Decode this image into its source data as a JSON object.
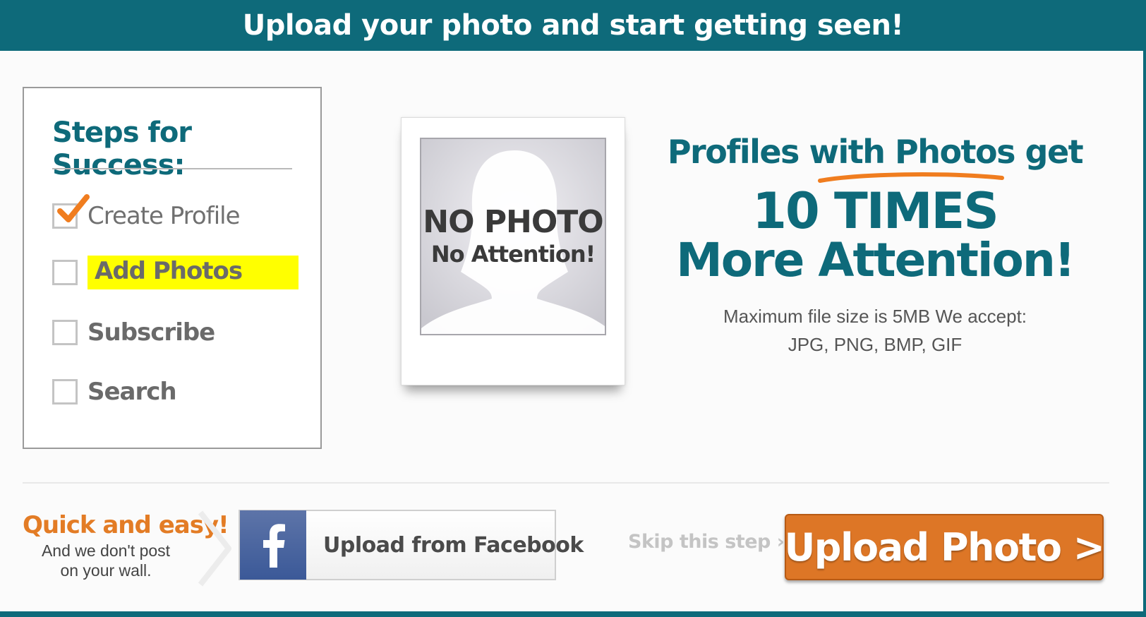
{
  "header": {
    "title": "Upload your photo and start getting seen!"
  },
  "steps": {
    "title": "Steps for Success:",
    "items": [
      {
        "label": "Create Profile",
        "checked": true
      },
      {
        "label": "Add Photos",
        "checked": false,
        "highlighted": true
      },
      {
        "label": "Subscribe",
        "checked": false
      },
      {
        "label": "Search",
        "checked": false
      }
    ]
  },
  "placeholder_photo": {
    "line1": "NO PHOTO",
    "line2": "No Attention!"
  },
  "promo": {
    "line1_prefix": "Profiles ",
    "line1_emphasis": "with Photos",
    "line1_suffix": " get",
    "line2": "10 TIMES",
    "line3": "More Attention!",
    "file_info_line1": "Maximum file size is 5MB We accept:",
    "file_info_line2": "JPG, PNG, BMP, GIF"
  },
  "bottom": {
    "quick_title": "Quick and easy!",
    "quick_sub_line1": "And we don't post",
    "quick_sub_line2": "on your wall.",
    "facebook_button": "Upload from Facebook",
    "facebook_icon": "facebook-icon",
    "skip_link": "Skip this step ›",
    "upload_button": "Upload Photo >"
  },
  "colors": {
    "teal": "#0e6a7a",
    "orange": "#dd7626",
    "highlight": "#ffff00",
    "facebook": "#3b5998"
  }
}
